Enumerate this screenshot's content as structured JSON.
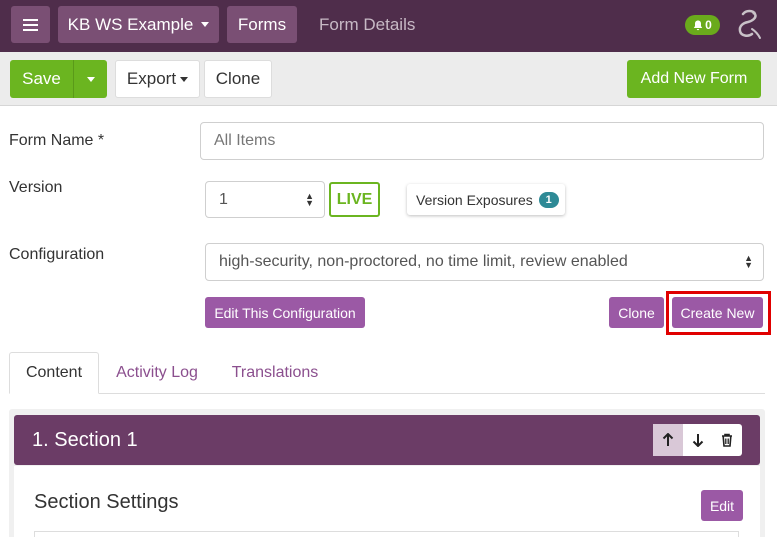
{
  "nav": {
    "org_label": "KB WS Example",
    "forms_label": "Forms",
    "breadcrumb": "Form Details",
    "notification_count": "0"
  },
  "toolbar": {
    "save_label": "Save",
    "export_label": "Export",
    "clone_label": "Clone",
    "add_new_form_label": "Add New Form"
  },
  "form": {
    "name_label": "Form Name *",
    "name_value": "All Items",
    "version_label": "Version",
    "version_value": "1",
    "live_label": "LIVE",
    "version_exposures_label": "Version Exposures",
    "version_exposures_count": "1",
    "configuration_label": "Configuration",
    "configuration_value": "high-security, non-proctored, no time limit, review enabled",
    "edit_configuration_label": "Edit This Configuration",
    "clone_configuration_label": "Clone",
    "create_new_label": "Create New"
  },
  "tabs": [
    {
      "label": "Content",
      "active": true
    },
    {
      "label": "Activity Log",
      "active": false
    },
    {
      "label": "Translations",
      "active": false
    }
  ],
  "section": {
    "title": "1. Section 1",
    "settings_title": "Section Settings",
    "edit_label": "Edit"
  },
  "colors": {
    "nav_bg": "#4f2d4b",
    "brand_green": "#6bb520",
    "accent_purple": "#9b59a5",
    "section_header": "#6b3c66",
    "highlight": "#e00000"
  }
}
